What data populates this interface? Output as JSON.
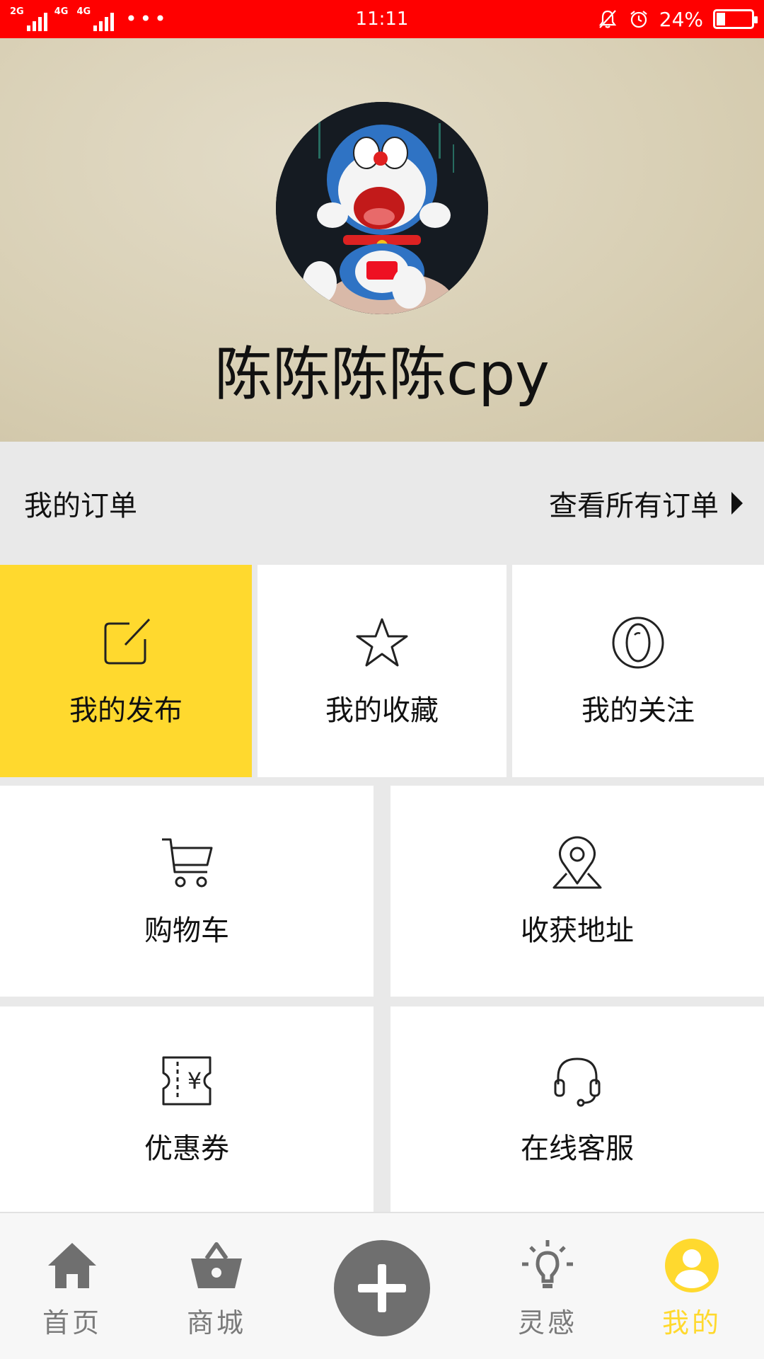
{
  "status_bar": {
    "network_1": "2G",
    "network_2": "4G",
    "network_3": "4G",
    "more": "•••",
    "time": "11:11",
    "battery": "24%"
  },
  "profile": {
    "username": "陈陈陈陈cpy"
  },
  "orders": {
    "title": "我的订单",
    "view_all": "查看所有订单"
  },
  "tiles": {
    "publish": "我的发布",
    "favorites": "我的收藏",
    "follow": "我的关注",
    "cart": "购物车",
    "address": "收获地址",
    "coupon": "优惠券",
    "service": "在线客服"
  },
  "nav": {
    "home": "首页",
    "mall": "商城",
    "inspiration": "灵感",
    "mine": "我的"
  },
  "colors": {
    "status_bar": "#ff0000",
    "accent": "#ffd92e",
    "nav_inactive": "#7a7a7a"
  }
}
